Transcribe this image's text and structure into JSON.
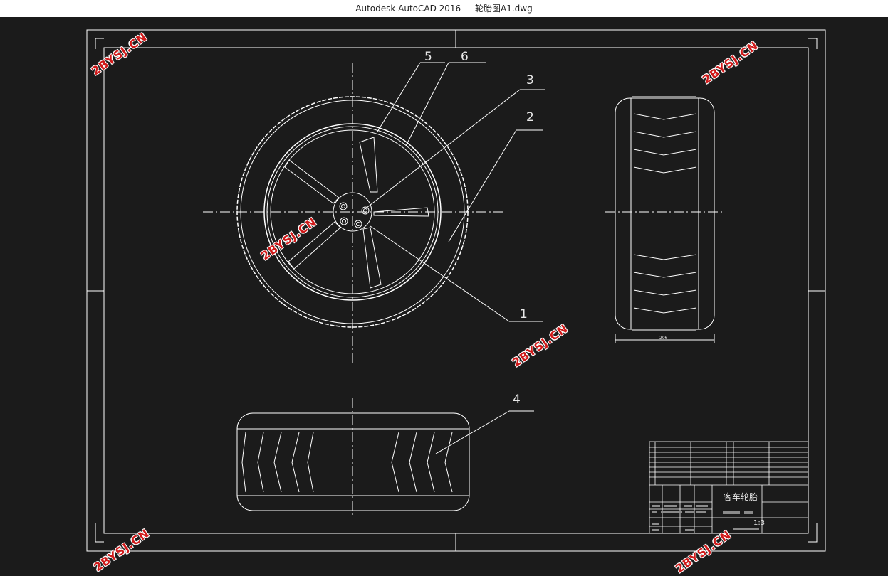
{
  "window": {
    "app_title": "Autodesk AutoCAD 2016",
    "file_name": "轮胎图A1.dwg"
  },
  "drawing": {
    "part_labels": [
      "1",
      "2",
      "3",
      "4",
      "5",
      "6"
    ],
    "title_block": {
      "drawing_title": "客车轮胎",
      "scale": "1:3"
    },
    "side_view_dimension": "206"
  },
  "watermark": {
    "text": "2BYSJ.CN",
    "color": "#d01a1a"
  },
  "colors": {
    "background": "#1b1b1b",
    "lines": "#ffffff"
  }
}
